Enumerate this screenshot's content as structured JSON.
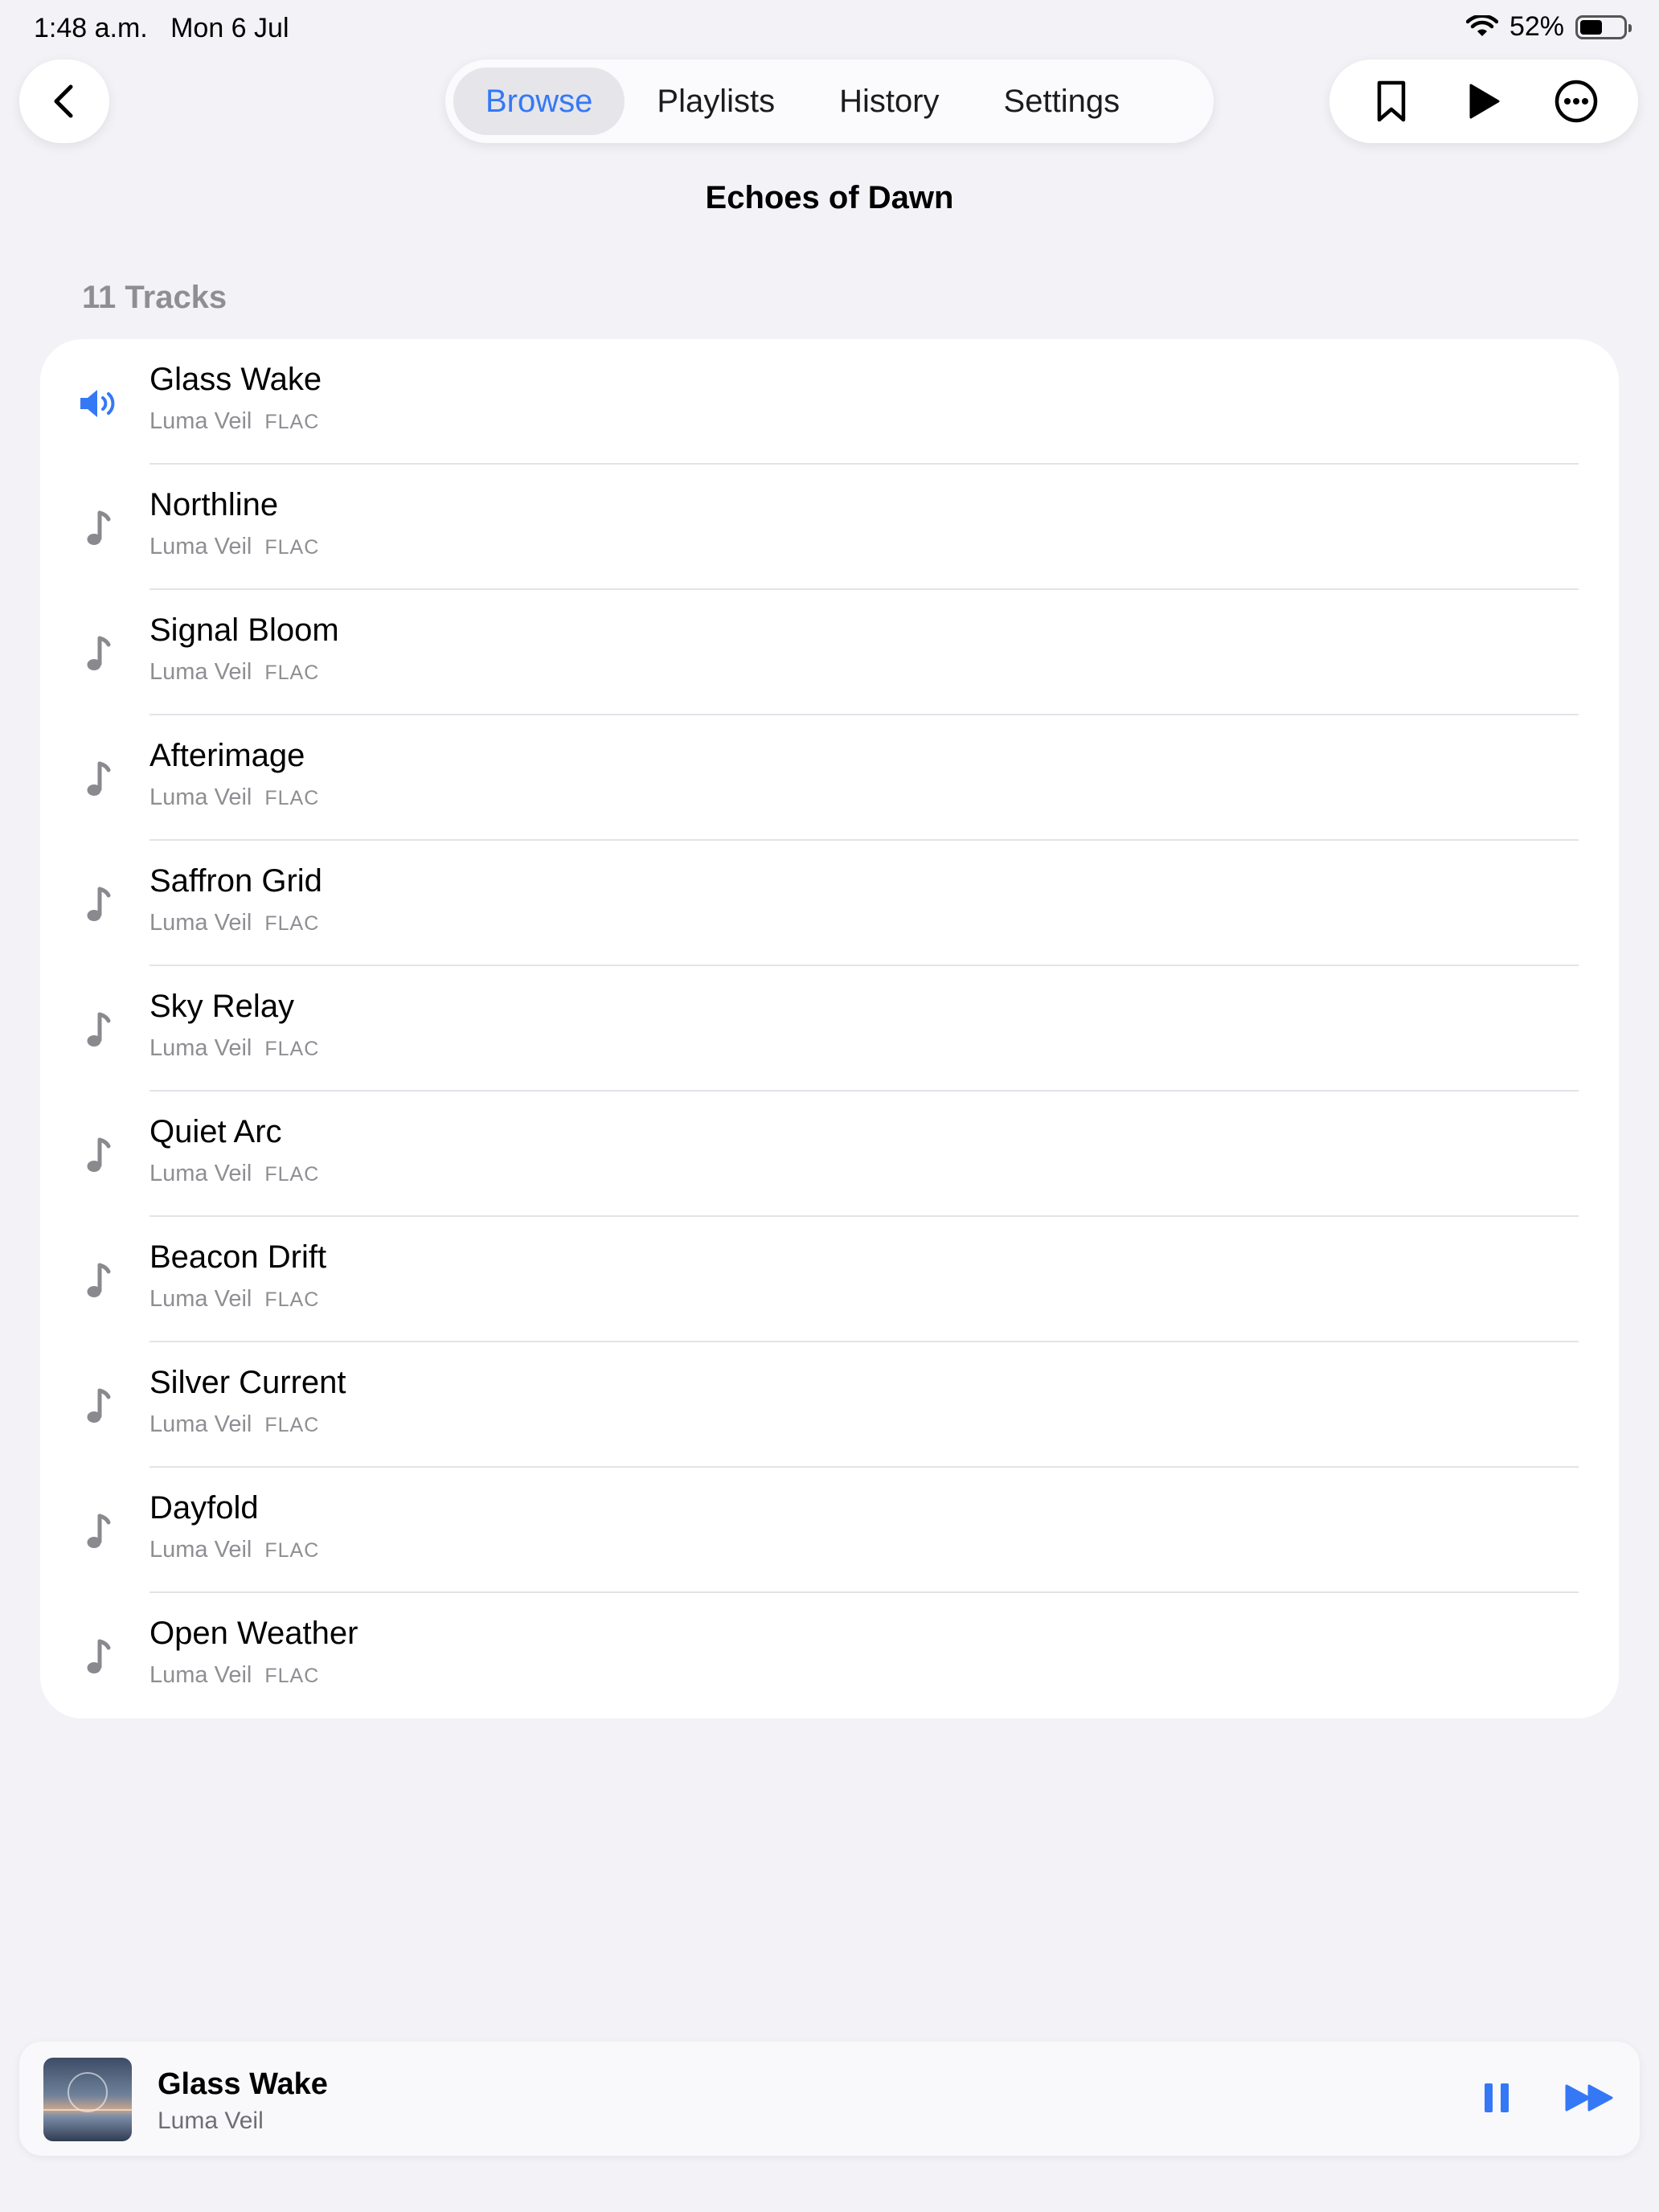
{
  "status_bar": {
    "time": "1:48 a.m.",
    "date": "Mon 6 Jul",
    "battery": "52%",
    "wifi_icon": "wifi-icon",
    "battery_icon": "battery-icon"
  },
  "nav": {
    "back_icon": "chevron-left-icon",
    "tabs": [
      {
        "label": "Browse",
        "active": true
      },
      {
        "label": "Playlists",
        "active": false
      },
      {
        "label": "History",
        "active": false
      },
      {
        "label": "Settings",
        "active": false
      }
    ],
    "actions": [
      "bookmark-icon",
      "play-icon",
      "ellipsis-circle-icon"
    ]
  },
  "album": {
    "title": "Echoes of Dawn",
    "track_count_label": "11 Tracks"
  },
  "tracks": [
    {
      "title": "Glass Wake",
      "artist": "Luma Veil",
      "format": "FLAC",
      "playing": true
    },
    {
      "title": "Northline",
      "artist": "Luma Veil",
      "format": "FLAC",
      "playing": false
    },
    {
      "title": "Signal Bloom",
      "artist": "Luma Veil",
      "format": "FLAC",
      "playing": false
    },
    {
      "title": "Afterimage",
      "artist": "Luma Veil",
      "format": "FLAC",
      "playing": false
    },
    {
      "title": "Saffron Grid",
      "artist": "Luma Veil",
      "format": "FLAC",
      "playing": false
    },
    {
      "title": "Sky Relay",
      "artist": "Luma Veil",
      "format": "FLAC",
      "playing": false
    },
    {
      "title": "Quiet Arc",
      "artist": "Luma Veil",
      "format": "FLAC",
      "playing": false
    },
    {
      "title": "Beacon Drift",
      "artist": "Luma Veil",
      "format": "FLAC",
      "playing": false
    },
    {
      "title": "Silver Current",
      "artist": "Luma Veil",
      "format": "FLAC",
      "playing": false
    },
    {
      "title": "Dayfold",
      "artist": "Luma Veil",
      "format": "FLAC",
      "playing": false
    },
    {
      "title": "Open Weather",
      "artist": "Luma Veil",
      "format": "FLAC",
      "playing": false
    }
  ],
  "mini_player": {
    "title": "Glass Wake",
    "artist": "Luma Veil",
    "pause_icon": "pause-icon",
    "next_icon": "forward-icon"
  },
  "colors": {
    "accent": "#3478f6",
    "background": "#f2f2f7",
    "secondary_text": "#8e8e93"
  }
}
